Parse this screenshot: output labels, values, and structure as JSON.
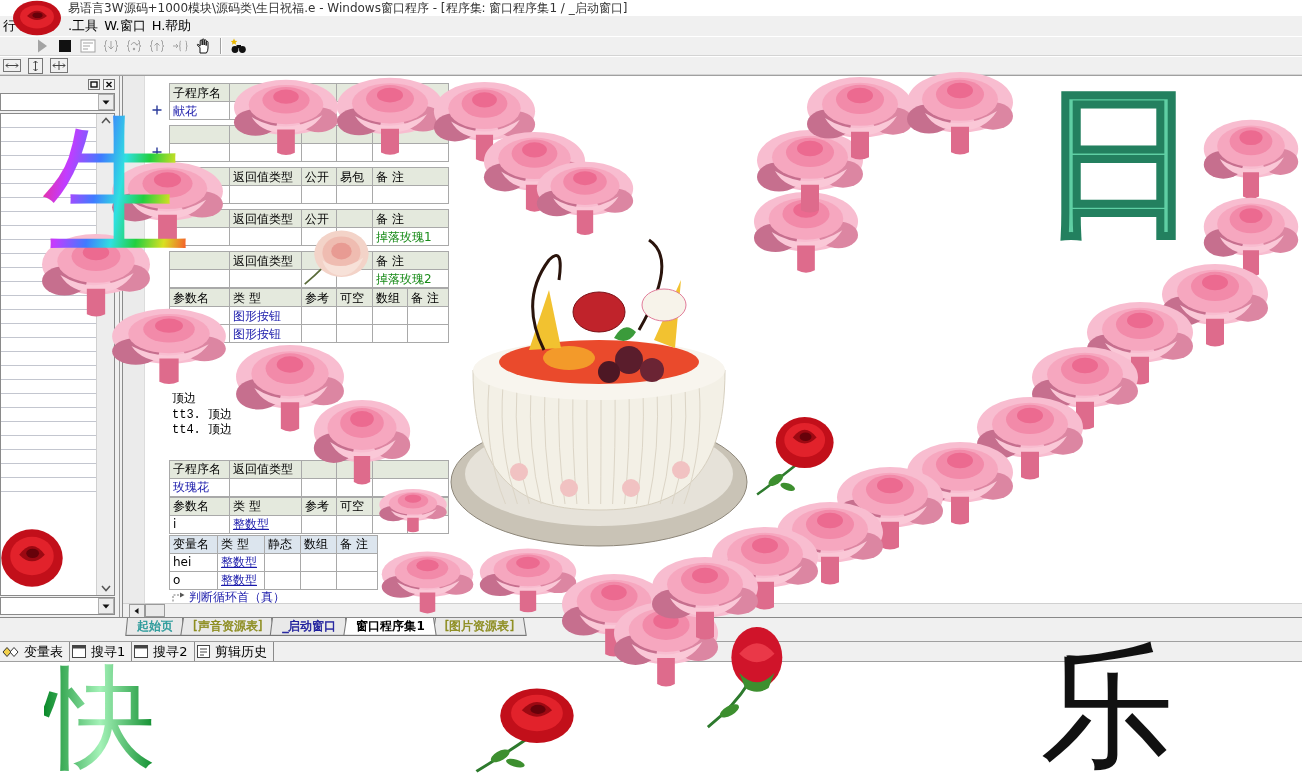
{
  "window": {
    "title": "易语言3W源码+1000模块\\源码类\\生日祝福.e - Windows窗口程序 - [程序集: 窗口程序集1 / _启动窗口]"
  },
  "menu": [
    "行",
    ".工具",
    "W.窗口",
    "H.帮助"
  ],
  "toolbar": [
    {
      "disabled": true
    },
    {
      "disabled": false
    },
    {
      "disabled": true
    },
    {
      "disabled": true
    },
    {
      "disabled": true
    },
    {
      "disabled": true
    },
    {
      "disabled": true
    },
    {
      "disabled": false
    },
    {
      "disabled": false
    }
  ],
  "editor": {
    "items": [
      {
        "kind": "sub",
        "expanded": false,
        "header": {
          "name": "子程序名"
        },
        "rows": [
          {
            "name": "献花"
          }
        ]
      },
      {
        "kind": "sub",
        "expanded": false
      },
      {
        "kind": "sub",
        "header": {
          "return_type": "返回值类型",
          "public": "公开",
          "package": "易包",
          "remark": "备 注"
        }
      },
      {
        "kind": "sub",
        "header": {
          "return_type": "返回值类型",
          "public": "公开",
          "remark": "备 注"
        },
        "rows": [
          {
            "remark": "掉落玫瑰1"
          }
        ]
      },
      {
        "kind": "sub",
        "header": {
          "return_type": "返回值类型",
          "remark": "备 注"
        },
        "rows": [
          {
            "remark": "掉落玫瑰2"
          }
        ],
        "params": {
          "header": {
            "name": "参数名",
            "type": "类 型",
            "reference": "参考",
            "nullable": "可空",
            "array": "数组",
            "remark": "备 注"
          },
          "underlined": false,
          "rows": [
            {
              "type": "图形按钮"
            },
            {
              "type": "图形按钮"
            }
          ]
        }
      },
      {
        "kind": "code",
        "lines": [
          "顶边",
          "tt3. 顶边",
          "tt4. 顶边"
        ]
      },
      {
        "kind": "sub",
        "header": {
          "name": "子程序名",
          "return_type": "返回值类型"
        },
        "rows": [
          {
            "name": "玫瑰花"
          }
        ],
        "params": {
          "header": {
            "name": "参数名",
            "type": "类 型",
            "reference": "参考",
            "nullable": "可空"
          },
          "underlined": true,
          "rows": [
            {
              "name": "i",
              "type": "整数型"
            }
          ]
        }
      },
      {
        "kind": "vars",
        "header": {
          "name": "变量名",
          "type": "类 型",
          "static": "静态",
          "array": "数组",
          "remark": "备 注"
        },
        "underlined": true,
        "rows": [
          {
            "name": "hei",
            "type": "整数型"
          },
          {
            "name": "o",
            "type": "整数型"
          }
        ]
      },
      {
        "kind": "flow",
        "text": "判断循环首（真）"
      }
    ]
  },
  "doc_tabs": [
    {
      "label": "起始页",
      "color": "#2a9a9a",
      "selected": false
    },
    {
      "label": "[声音资源表]",
      "color": "#8c8c1e",
      "selected": false
    },
    {
      "label": "_启动窗口",
      "color": "#1c1c9c",
      "selected": false
    },
    {
      "label": "窗口程序集1",
      "color": "#000000",
      "selected": true
    },
    {
      "label": "[图片资源表]",
      "color": "#8c8c1e",
      "selected": false
    }
  ],
  "panel_tabs": [
    "变量表",
    "搜寻1",
    "搜寻2",
    "剪辑历史"
  ],
  "greeting": [
    {
      "text": "生",
      "kind": "rainbow"
    },
    {
      "text": "日",
      "kind": "embossed"
    },
    {
      "text": "快",
      "kind": "gradient"
    },
    {
      "text": "乐",
      "kind": "plain"
    }
  ]
}
